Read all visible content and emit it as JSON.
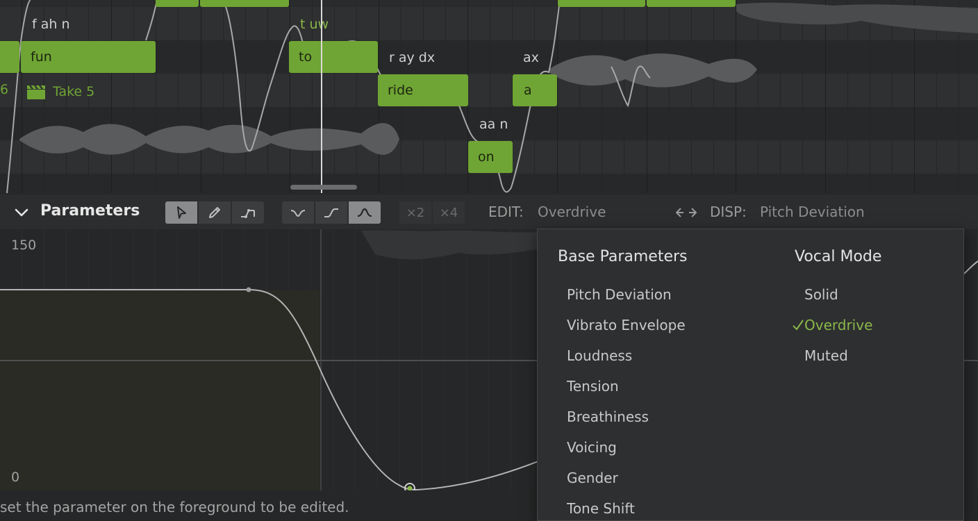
{
  "piano_roll": {
    "notes": [
      {
        "lyric": "fun",
        "phonemes": "f ah n"
      },
      {
        "lyric": "to",
        "phonemes": "t uw"
      },
      {
        "lyric": "ride",
        "phonemes": "r ay dx"
      },
      {
        "lyric": "on",
        "phonemes": "aa n"
      },
      {
        "lyric": "a",
        "phonemes": "ax"
      }
    ],
    "take_prev_label": "6",
    "take_label": "Take 5"
  },
  "parameters_panel": {
    "title": "Parameters",
    "tools": [
      "select-tool",
      "pencil-tool",
      "line-tool"
    ],
    "curve_shapes": [
      "valley-curve",
      "ramp-curve",
      "peak-curve"
    ],
    "multipliers": [
      "×2",
      "×4"
    ],
    "edit_label": "EDIT:",
    "edit_value": "Overdrive",
    "swap_icon": "swap-arrows-icon",
    "disp_label": "DISP:",
    "disp_value": "Pitch Deviation",
    "y_max_label": "150",
    "y_min_label": "0"
  },
  "dropdown": {
    "base_header": "Base Parameters",
    "base_items": [
      "Pitch Deviation",
      "Vibrato Envelope",
      "Loudness",
      "Tension",
      "Breathiness",
      "Voicing",
      "Gender",
      "Tone Shift"
    ],
    "mode_header": "Vocal Mode",
    "mode_items": [
      "Solid",
      "Overdrive",
      "Muted"
    ],
    "mode_selected": "Overdrive"
  },
  "status_text": "set the parameter on the foreground to be edited.",
  "colors": {
    "note_green": "#6fa534",
    "selected_green": "#8ab84a",
    "background": "#262728"
  }
}
